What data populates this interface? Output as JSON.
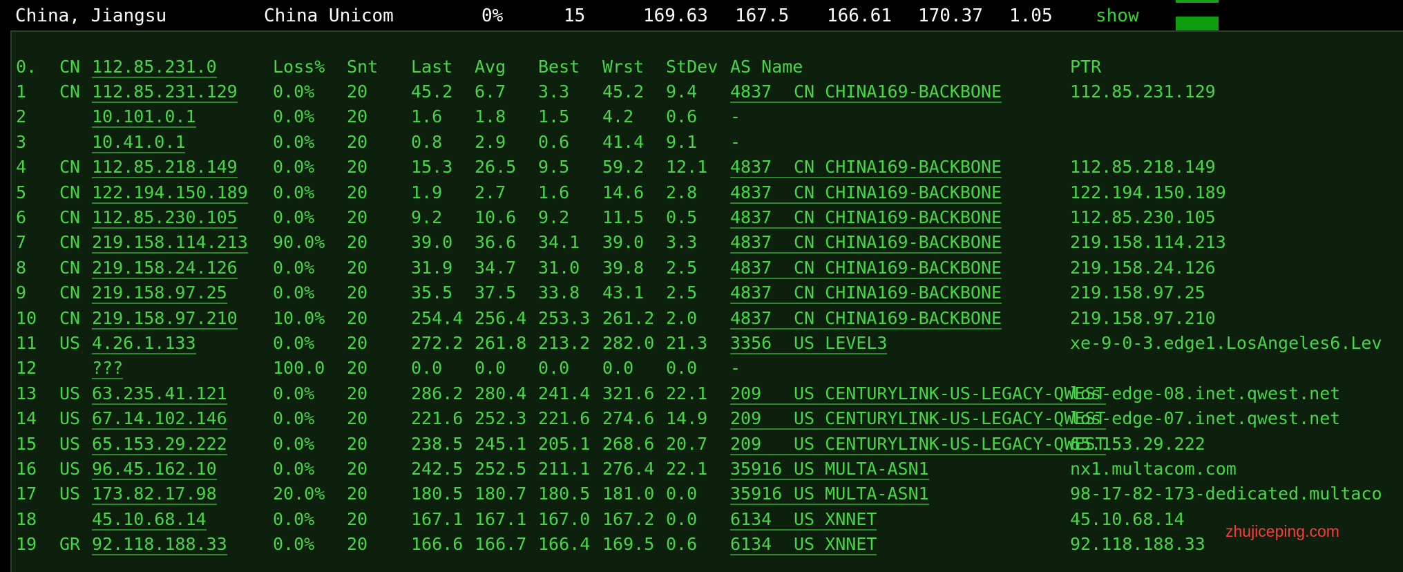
{
  "summary": {
    "location": "China, Jiangsu",
    "isp": "China Unicom",
    "loss": "0%",
    "sent": "15",
    "last": "169.63",
    "avg": "167.5",
    "best": "166.61",
    "worst": "170.37",
    "stdev": "1.05",
    "action": "show"
  },
  "header": {
    "hop": "0.",
    "cc": "CN",
    "host": "112.85.231.0",
    "loss": "Loss%",
    "snt": "Snt",
    "last": "Last",
    "avg": "Avg",
    "best": "Best",
    "wrst": "Wrst",
    "stdev": "StDev",
    "as_name": "AS Name",
    "ptr": "PTR"
  },
  "hops": [
    {
      "hop": "1",
      "cc": "CN",
      "host": "112.85.231.129",
      "loss": "0.0%",
      "snt": "20",
      "last": "45.2",
      "avg": "6.7",
      "best": "3.3",
      "wrst": "45.2",
      "stdev": "9.4",
      "asn": "4837",
      "as_cc": "CN",
      "as_name": "CHINA169-BACKBONE",
      "ptr": "112.85.231.129"
    },
    {
      "hop": "2",
      "cc": "",
      "host": "10.101.0.1",
      "loss": "0.0%",
      "snt": "20",
      "last": "1.6",
      "avg": "1.8",
      "best": "1.5",
      "wrst": "4.2",
      "stdev": "0.6",
      "asn": "-",
      "as_cc": "",
      "as_name": "",
      "ptr": ""
    },
    {
      "hop": "3",
      "cc": "",
      "host": "10.41.0.1",
      "loss": "0.0%",
      "snt": "20",
      "last": "0.8",
      "avg": "2.9",
      "best": "0.6",
      "wrst": "41.4",
      "stdev": "9.1",
      "asn": "-",
      "as_cc": "",
      "as_name": "",
      "ptr": ""
    },
    {
      "hop": "4",
      "cc": "CN",
      "host": "112.85.218.149",
      "loss": "0.0%",
      "snt": "20",
      "last": "15.3",
      "avg": "26.5",
      "best": "9.5",
      "wrst": "59.2",
      "stdev": "12.1",
      "asn": "4837",
      "as_cc": "CN",
      "as_name": "CHINA169-BACKBONE",
      "ptr": "112.85.218.149"
    },
    {
      "hop": "5",
      "cc": "CN",
      "host": "122.194.150.189",
      "loss": "0.0%",
      "snt": "20",
      "last": "1.9",
      "avg": "2.7",
      "best": "1.6",
      "wrst": "14.6",
      "stdev": "2.8",
      "asn": "4837",
      "as_cc": "CN",
      "as_name": "CHINA169-BACKBONE",
      "ptr": "122.194.150.189"
    },
    {
      "hop": "6",
      "cc": "CN",
      "host": "112.85.230.105",
      "loss": "0.0%",
      "snt": "20",
      "last": "9.2",
      "avg": "10.6",
      "best": "9.2",
      "wrst": "11.5",
      "stdev": "0.5",
      "asn": "4837",
      "as_cc": "CN",
      "as_name": "CHINA169-BACKBONE",
      "ptr": "112.85.230.105"
    },
    {
      "hop": "7",
      "cc": "CN",
      "host": "219.158.114.213",
      "loss": "90.0%",
      "snt": "20",
      "last": "39.0",
      "avg": "36.6",
      "best": "34.1",
      "wrst": "39.0",
      "stdev": "3.3",
      "asn": "4837",
      "as_cc": "CN",
      "as_name": "CHINA169-BACKBONE",
      "ptr": "219.158.114.213"
    },
    {
      "hop": "8",
      "cc": "CN",
      "host": "219.158.24.126",
      "loss": "0.0%",
      "snt": "20",
      "last": "31.9",
      "avg": "34.7",
      "best": "31.0",
      "wrst": "39.8",
      "stdev": "2.5",
      "asn": "4837",
      "as_cc": "CN",
      "as_name": "CHINA169-BACKBONE",
      "ptr": "219.158.24.126"
    },
    {
      "hop": "9",
      "cc": "CN",
      "host": "219.158.97.25",
      "loss": "0.0%",
      "snt": "20",
      "last": "35.5",
      "avg": "37.5",
      "best": "33.8",
      "wrst": "43.1",
      "stdev": "2.5",
      "asn": "4837",
      "as_cc": "CN",
      "as_name": "CHINA169-BACKBONE",
      "ptr": "219.158.97.25"
    },
    {
      "hop": "10",
      "cc": "CN",
      "host": "219.158.97.210",
      "loss": "10.0%",
      "snt": "20",
      "last": "254.4",
      "avg": "256.4",
      "best": "253.3",
      "wrst": "261.2",
      "stdev": "2.0",
      "asn": "4837",
      "as_cc": "CN",
      "as_name": "CHINA169-BACKBONE",
      "ptr": "219.158.97.210"
    },
    {
      "hop": "11",
      "cc": "US",
      "host": "4.26.1.133",
      "loss": "0.0%",
      "snt": "20",
      "last": "272.2",
      "avg": "261.8",
      "best": "213.2",
      "wrst": "282.0",
      "stdev": "21.3",
      "asn": "3356",
      "as_cc": "US",
      "as_name": "LEVEL3",
      "ptr": "xe-9-0-3.edge1.LosAngeles6.Lev"
    },
    {
      "hop": "12",
      "cc": "",
      "host": "???",
      "loss": "100.0",
      "snt": "20",
      "last": "0.0",
      "avg": "0.0",
      "best": "0.0",
      "wrst": "0.0",
      "stdev": "0.0",
      "asn": "-",
      "as_cc": "",
      "as_name": "",
      "ptr": ""
    },
    {
      "hop": "13",
      "cc": "US",
      "host": "63.235.41.121",
      "loss": "0.0%",
      "snt": "20",
      "last": "286.2",
      "avg": "280.4",
      "best": "241.4",
      "wrst": "321.6",
      "stdev": "22.1",
      "asn": "209",
      "as_cc": "US",
      "as_name": "CENTURYLINK-US-LEGACY-QWEST",
      "ptr": "los-edge-08.inet.qwest.net"
    },
    {
      "hop": "14",
      "cc": "US",
      "host": "67.14.102.146",
      "loss": "0.0%",
      "snt": "20",
      "last": "221.6",
      "avg": "252.3",
      "best": "221.6",
      "wrst": "274.6",
      "stdev": "14.9",
      "asn": "209",
      "as_cc": "US",
      "as_name": "CENTURYLINK-US-LEGACY-QWEST",
      "ptr": "los-edge-07.inet.qwest.net"
    },
    {
      "hop": "15",
      "cc": "US",
      "host": "65.153.29.222",
      "loss": "0.0%",
      "snt": "20",
      "last": "238.5",
      "avg": "245.1",
      "best": "205.1",
      "wrst": "268.6",
      "stdev": "20.7",
      "asn": "209",
      "as_cc": "US",
      "as_name": "CENTURYLINK-US-LEGACY-QWEST",
      "ptr": "65.153.29.222"
    },
    {
      "hop": "16",
      "cc": "US",
      "host": "96.45.162.10",
      "loss": "0.0%",
      "snt": "20",
      "last": "242.5",
      "avg": "252.5",
      "best": "211.1",
      "wrst": "276.4",
      "stdev": "22.1",
      "asn": "35916",
      "as_cc": "US",
      "as_name": "MULTA-ASN1",
      "ptr": "nx1.multacom.com"
    },
    {
      "hop": "17",
      "cc": "US",
      "host": "173.82.17.98",
      "loss": "20.0%",
      "snt": "20",
      "last": "180.5",
      "avg": "180.7",
      "best": "180.5",
      "wrst": "181.0",
      "stdev": "0.0",
      "asn": "35916",
      "as_cc": "US",
      "as_name": "MULTA-ASN1",
      "ptr": "98-17-82-173-dedicated.multaco"
    },
    {
      "hop": "18",
      "cc": "",
      "host": "45.10.68.14",
      "loss": "0.0%",
      "snt": "20",
      "last": "167.1",
      "avg": "167.1",
      "best": "167.0",
      "wrst": "167.2",
      "stdev": "0.0",
      "asn": "6134",
      "as_cc": "US",
      "as_name": "XNNET",
      "ptr": "45.10.68.14"
    },
    {
      "hop": "19",
      "cc": "GR",
      "host": "92.118.188.33",
      "loss": "0.0%",
      "snt": "20",
      "last": "166.6",
      "avg": "166.7",
      "best": "166.4",
      "wrst": "169.5",
      "stdev": "0.6",
      "asn": "6134",
      "as_cc": "US",
      "as_name": "XNNET",
      "ptr": "92.118.188.33"
    }
  ],
  "watermark": "zhujiceping.com",
  "colors": {
    "terminal_bg": "#0d200d",
    "text_green": "#46d646",
    "show_link": "#2ed52e",
    "bar_green": "#0f9d0f",
    "watermark_red": "#ff3a3a"
  }
}
